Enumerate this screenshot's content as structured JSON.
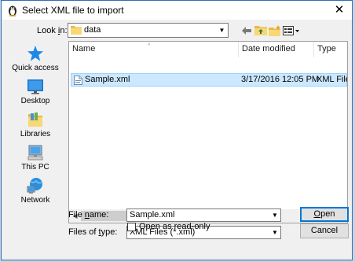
{
  "window": {
    "title": "Select XML file to import",
    "close_glyph": "✕"
  },
  "look_in": {
    "label_pre": "Look ",
    "label_key": "i",
    "label_post": "n:",
    "value": "data"
  },
  "toolbar": {
    "back_icon": "back-arrow-icon",
    "up_icon": "up-folder-icon",
    "new_folder_icon": "new-folder-icon",
    "view_icon": "view-menu-icon"
  },
  "places": [
    {
      "label": "Quick access",
      "icon": "star-icon"
    },
    {
      "label": "Desktop",
      "icon": "desktop-icon"
    },
    {
      "label": "Libraries",
      "icon": "libraries-icon"
    },
    {
      "label": "This PC",
      "icon": "computer-icon"
    },
    {
      "label": "Network",
      "icon": "network-icon"
    }
  ],
  "columns": {
    "name": "Name",
    "date": "Date modified",
    "type": "Type"
  },
  "files": [
    {
      "name": "Sample.xml",
      "date": "3/17/2016 12:05 PM",
      "type": "XML File",
      "selected": true
    }
  ],
  "file_name": {
    "label_pre": "File ",
    "label_key": "n",
    "label_post": "ame:",
    "value": "Sample.xml"
  },
  "files_of_type": {
    "label_pre": "Files of ",
    "label_key": "t",
    "label_post": "ype:",
    "value": "XML Files (*.xml)"
  },
  "read_only": {
    "label": "Open as read-only",
    "checked": false
  },
  "buttons": {
    "open_key": "O",
    "open_rest": "pen",
    "cancel": "Cancel"
  },
  "colors": {
    "selection": "#cce8ff",
    "accent": "#0078d7",
    "folder": "#f8d775"
  }
}
